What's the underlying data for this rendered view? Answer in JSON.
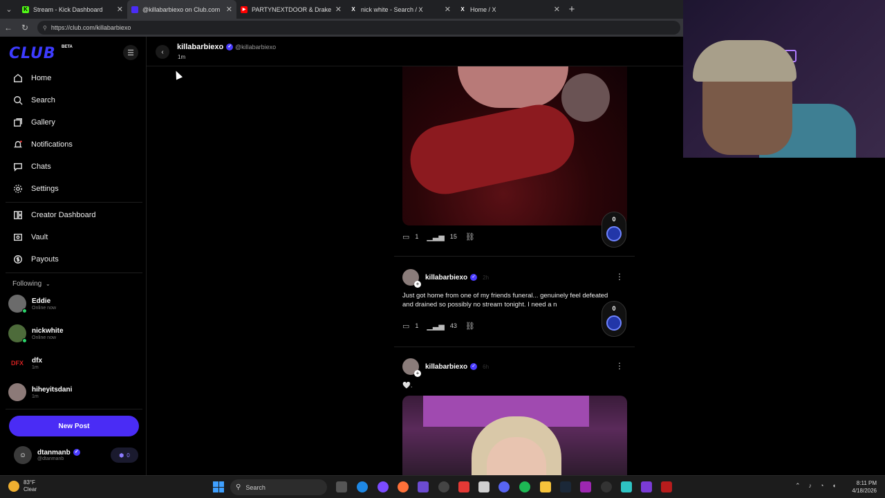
{
  "browser": {
    "tabs": [
      {
        "label": "Stream - Kick Dashboard",
        "fav_color": "#53fc18",
        "fav_glyph": "K",
        "active": false
      },
      {
        "label": "@killabarbiexo on Club.com",
        "fav_color": "#4a2cf5",
        "fav_glyph": "",
        "active": true
      },
      {
        "label": "PARTYNEXTDOOR & Drake - SOM",
        "fav_color": "#ff0000",
        "fav_glyph": "▶",
        "active": false
      },
      {
        "label": "nick white - Search / X",
        "fav_color": "#000000",
        "fav_glyph": "X",
        "active": false
      },
      {
        "label": "Home / X",
        "fav_color": "#000000",
        "fav_glyph": "X",
        "active": false
      }
    ],
    "url": "https://club.com/killabarbiexo"
  },
  "sidebar": {
    "logo": "CLUB",
    "beta": "BETA",
    "nav": [
      {
        "label": "Home",
        "icon": "home-icon"
      },
      {
        "label": "Search",
        "icon": "search-icon"
      },
      {
        "label": "Gallery",
        "icon": "gallery-icon"
      },
      {
        "label": "Notifications",
        "icon": "bell-icon"
      },
      {
        "label": "Chats",
        "icon": "chat-icon"
      },
      {
        "label": "Settings",
        "icon": "gear-icon"
      }
    ],
    "creator_nav": [
      {
        "label": "Creator Dashboard",
        "icon": "dashboard-icon"
      },
      {
        "label": "Vault",
        "icon": "vault-icon"
      },
      {
        "label": "Payouts",
        "icon": "dollar-icon"
      }
    ],
    "following_label": "Following",
    "following": [
      {
        "name": "Eddie",
        "sub": "Online now",
        "online": true,
        "color": "#6b6b6b"
      },
      {
        "name": "nickwhite",
        "sub": "Online now",
        "online": true,
        "color": "#4d6b3a"
      },
      {
        "name": "dfx",
        "sub": "1m",
        "online": false,
        "color": "#000000"
      },
      {
        "name": "hiheyitsdani",
        "sub": "1m",
        "online": false,
        "color": "#8c7a78"
      }
    ],
    "new_post": "New Post",
    "me": {
      "name": "dtanmanb",
      "handle": "@dtanmanb",
      "coins": "0"
    }
  },
  "profile_header": {
    "name": "killabarbiexo",
    "handle": "@killabarbiexo",
    "time": "1m"
  },
  "posts": [
    {
      "comments": "1",
      "views": "15",
      "tips": "0"
    },
    {
      "author": "killabarbiexo",
      "time": "2h",
      "text": "Just got home from one of my friends funeral... genuinely feel defeated and drained so possibly no stream tonight. I need a n",
      "comments": "1",
      "views": "43",
      "tips": "0"
    },
    {
      "author": "killabarbiexo",
      "time": "6h",
      "text": "🤍."
    }
  ],
  "taskbar": {
    "weather_temp": "83°F",
    "weather_desc": "Clear",
    "search": "Search",
    "time": "8:11 PM",
    "date": "4/18/2026"
  },
  "colors": {
    "accent": "#4a2cf5",
    "verified": "#4a3cff"
  }
}
